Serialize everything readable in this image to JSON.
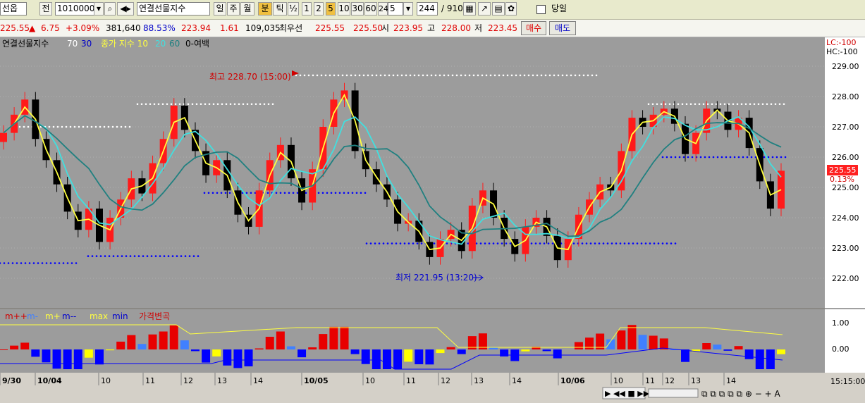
{
  "toolbar": {
    "market": "선옵",
    "jeon": "전",
    "code": "10100000",
    "name": "연결선물지수",
    "period_tabs": [
      "일",
      "주",
      "월",
      "분",
      "틱"
    ],
    "frac": "½",
    "intervals": [
      "1",
      "2",
      "5",
      "10",
      "30",
      "60",
      "240"
    ],
    "sel_interval": "5",
    "count": "244",
    "total": "/ 910",
    "today_label": "당일"
  },
  "quote": {
    "price": "225.55",
    "arrow": "▲",
    "change": "6.75",
    "pct": "+3.09%",
    "volume": "381,640",
    "ratio": "88.53%",
    "v1": "223.94",
    "v2": "1.61",
    "v3": "109,035",
    "best_label": "최우선",
    "ask": "225.55",
    "bid": "225.50",
    "open_label": "시",
    "open": "223.95",
    "high_label": "고",
    "high": "228.00",
    "low_label": "저",
    "low": "223.45",
    "buy": "매수",
    "sell": "매도"
  },
  "legend": {
    "name": "연결선물지수",
    "ma1": "70",
    "ma2": "30",
    "close_ma_label": "종가 지수 10",
    "ma3": "20",
    "ma4": "60",
    "blank": "0-여백"
  },
  "annot": {
    "high": "최고 228.70 (15:00)",
    "low": "최저 221.95 (13:20)"
  },
  "right_axis": {
    "lc": "LC:-100",
    "hc": "HC:-100",
    "prices": [
      "229.00",
      "228.00",
      "227.00",
      "226.00",
      "225.00",
      "224.00",
      "223.00",
      "222.00"
    ],
    "current": "225.55",
    "current_pct": "0.13%",
    "osc": [
      "1.00",
      "0.00"
    ]
  },
  "osc_legend": {
    "a": "m++",
    "b": "m-",
    "c": "m+",
    "d": "m--",
    "e": "max",
    "f": "min",
    "g": "가격변곡"
  },
  "x_axis": {
    "labels": [
      "9/30",
      "10/04",
      "10",
      "11",
      "12",
      "13",
      "14",
      "10/05",
      "10",
      "11",
      "12",
      "13",
      "14",
      "10/06",
      "10",
      "11",
      "12",
      "13",
      "14"
    ],
    "time": "15:15:00"
  },
  "chart_data": {
    "type": "candlestick",
    "y_axis_range": [
      221.2,
      229.5
    ],
    "y_ticks": [
      229,
      228,
      227,
      226,
      225,
      224,
      223,
      222
    ],
    "high": 228.7,
    "low": 221.95,
    "closes": [
      226.8,
      227.4,
      227.9,
      226.6,
      225.9,
      225.1,
      224.2,
      223.6,
      224.3,
      223.2,
      224.0,
      224.6,
      225.3,
      224.8,
      225.8,
      226.6,
      227.7,
      226.9,
      226.2,
      225.4,
      225.9,
      224.9,
      224.1,
      223.7,
      224.9,
      225.9,
      226.4,
      225.3,
      224.5,
      225.6,
      227.0,
      227.9,
      228.2,
      226.2,
      225.6,
      225.1,
      224.6,
      223.8,
      223.9,
      223.2,
      222.7,
      223.3,
      223.6,
      222.9,
      224.4,
      224.9,
      224.0,
      223.3,
      222.8,
      223.7,
      224.0,
      223.4,
      222.6,
      223.3,
      224.1,
      224.6,
      225.1,
      224.9,
      226.2,
      227.3,
      227.0,
      227.4,
      227.6,
      227.1,
      226.1,
      226.8,
      227.6,
      227.5,
      226.9,
      227.3,
      226.3,
      225.2,
      224.3,
      225.55
    ],
    "ma_fast": "yellow",
    "ma_mid": "cyan",
    "ma_slow": "teal"
  },
  "colors": {
    "up": "#ff1a1a",
    "down": "#000000",
    "ma1": "#ffff40",
    "ma2": "#40e0e0",
    "ma3": "#208080",
    "bg": "#9c9c9c",
    "osc_pos_a": "#e80000",
    "osc_pos_b": "#4080ff",
    "osc_neg_a": "#ffff00",
    "osc_neg_b": "#0000ff"
  }
}
